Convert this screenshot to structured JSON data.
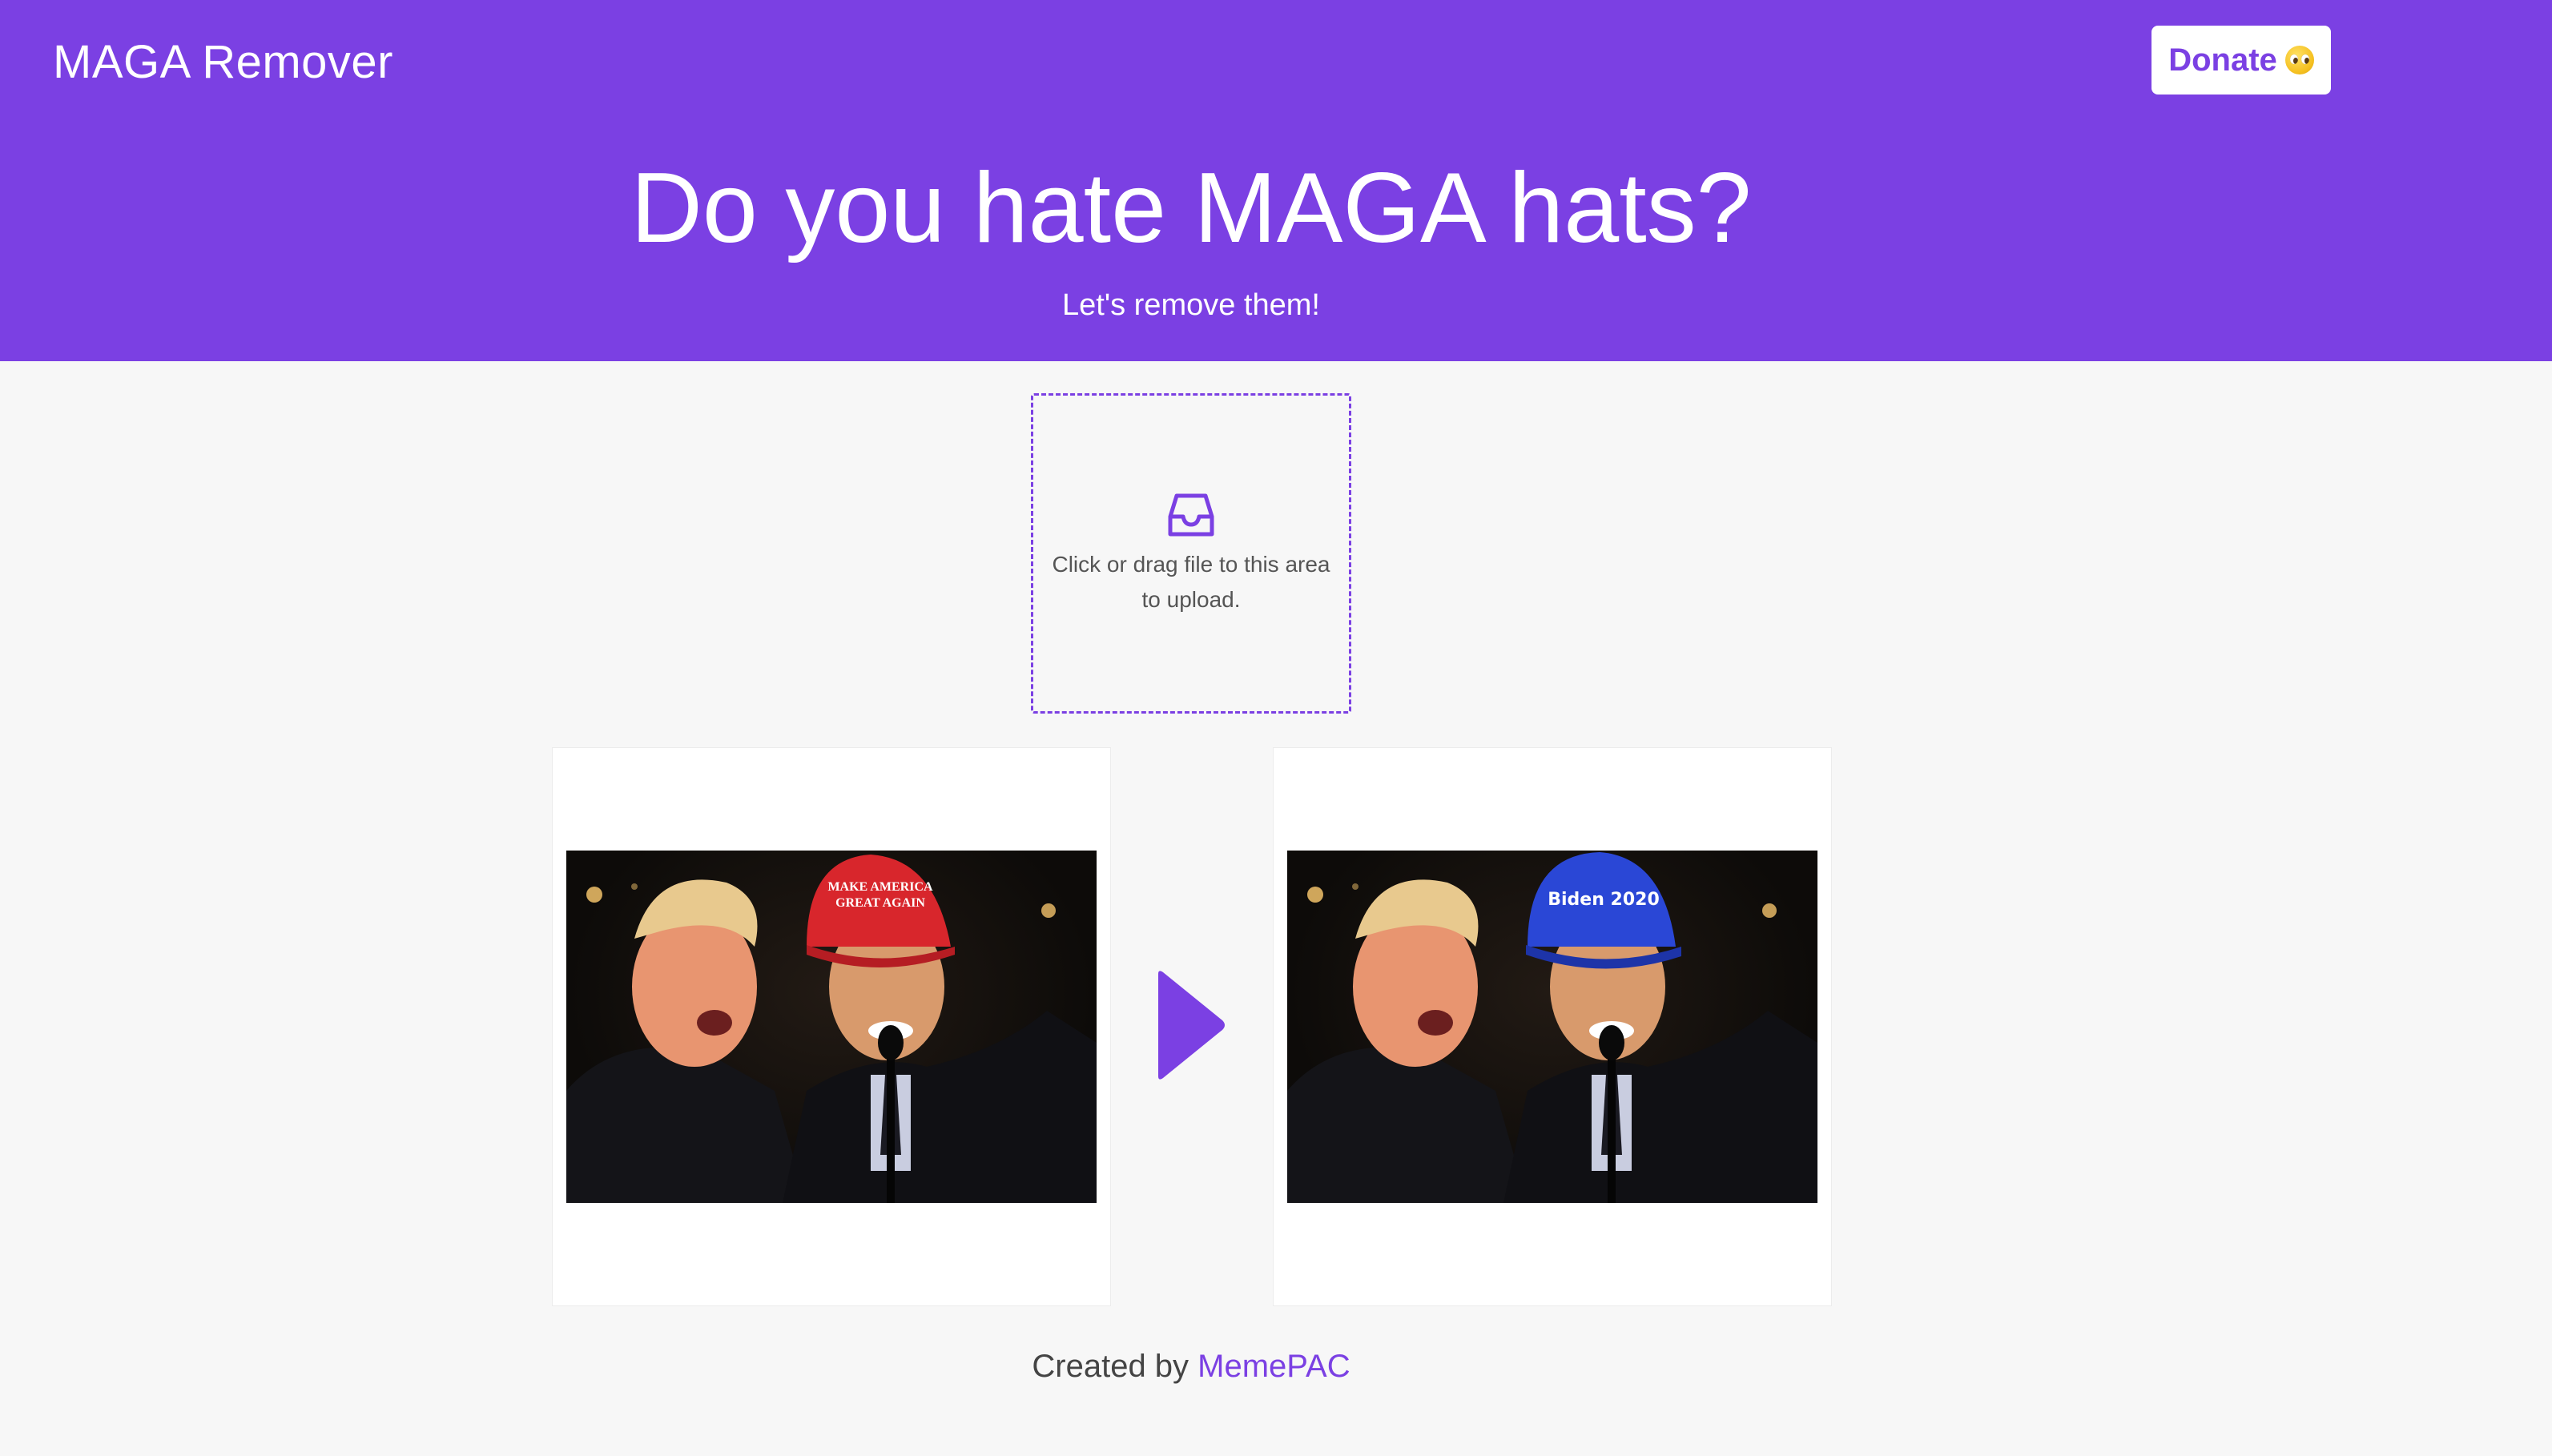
{
  "nav": {
    "brand": "MAGA Remover",
    "donate_label": "Donate"
  },
  "hero": {
    "title": "Do you hate MAGA hats?",
    "subtitle": "Let's remove them!"
  },
  "upload": {
    "hint": "Click or drag file to this area to upload.",
    "icon": "inbox-icon"
  },
  "comparison": {
    "before_hat_text_line1": "MAKE AMERICA",
    "before_hat_text_line2": "GREAT AGAIN",
    "after_hat_text": "Biden 2020",
    "arrow_icon": "play-arrow-icon"
  },
  "footer": {
    "prefix": "Created by ",
    "link_text": "MemePAC"
  },
  "colors": {
    "brand_purple": "#7b40e3",
    "background": "#f7f7f7",
    "red_hat": "#d8262c",
    "blue_hat": "#2a47d6"
  }
}
